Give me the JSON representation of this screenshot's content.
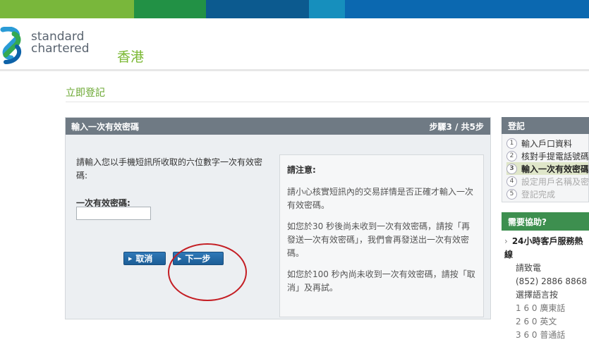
{
  "colors": {
    "bar": [
      "#79b73b",
      "#229145",
      "#0c5a8f",
      "#168fbd",
      "#0b68b0"
    ],
    "brand_green": "#7ab833",
    "panel_header": "#6f7a84",
    "button_blue": "#1c5d96",
    "help_green": "#3d8f4f",
    "annotation_red": "#c41e24"
  },
  "header": {
    "brand_line1": "standard",
    "brand_line2": "chartered",
    "region": "香港"
  },
  "page": {
    "title": "立即登記"
  },
  "panel": {
    "title": "輸入一次有效密碼",
    "step_indicator": "步驟3 / 共5步",
    "instruction": "請輸入您以手機短訊所收取的六位數字一次有效密碼:",
    "otp_label": "一次有效密碼:",
    "otp_value": "",
    "cancel_label": "取消",
    "next_label": "下一步"
  },
  "notice": {
    "title": "請注意:",
    "paragraphs": [
      "請小心核實短訊內的交易詳情是否正確才輸入一次有效密碼。",
      "如您於30 秒後尚未收到一次有效密碼，請按「再發送一次有效密碼」，我們會再發送出一次有效密碼。",
      "如您於100 秒內尚未收到一次有效密碼，請按「取消」及再試。"
    ]
  },
  "sidebar": {
    "title": "登記",
    "steps": [
      {
        "num": "1",
        "label": "輸入戶口資料"
      },
      {
        "num": "2",
        "label": "核對手提電話號碼"
      },
      {
        "num": "3",
        "label": "輸入一次有效密碼"
      },
      {
        "num": "4",
        "label": "設定用戶名稱及密碼"
      },
      {
        "num": "5",
        "label": "登記完成"
      }
    ],
    "help_title": "需要協助?",
    "hotline_label": "24小時客戶服務熱線",
    "call_label": "請致電",
    "phone": "(852) 2886 8868",
    "lang_label": "選擇語言按",
    "lang_options": [
      "1 6 0 廣東話",
      "2 6 0 英文",
      "3 6 0 普通話"
    ]
  }
}
